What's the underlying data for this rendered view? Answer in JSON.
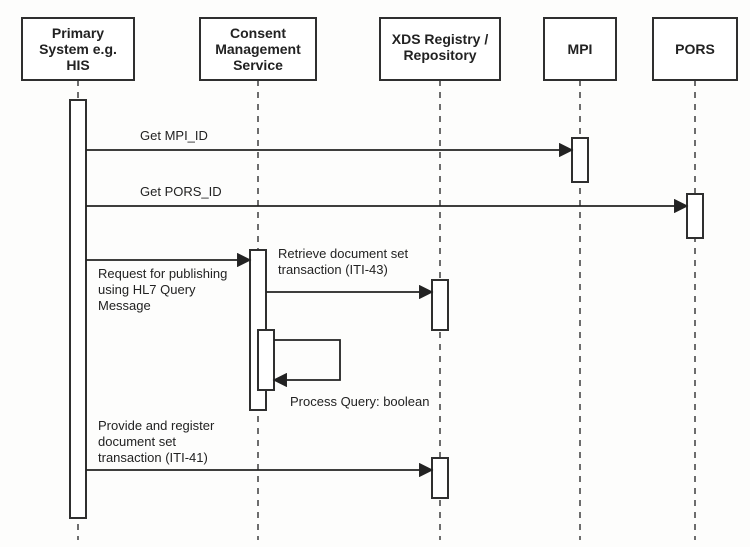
{
  "participants": [
    {
      "id": "primary",
      "lines": [
        "Primary",
        "System e.g.",
        "HIS"
      ]
    },
    {
      "id": "consent",
      "lines": [
        "Consent",
        "Management",
        "Service"
      ]
    },
    {
      "id": "xds",
      "lines": [
        "XDS Registry /",
        "Repository"
      ]
    },
    {
      "id": "mpi",
      "lines": [
        "MPI"
      ]
    },
    {
      "id": "pors",
      "lines": [
        "PORS"
      ]
    }
  ],
  "messages": {
    "m1": "Get MPI_ID",
    "m2": "Get PORS_ID",
    "m3a": "Request for publishing",
    "m3b": "using HL7 Query",
    "m3c": "Message",
    "m4a": "Retrieve document set",
    "m4b": "transaction (ITI-43)",
    "m5": "Process Query: boolean",
    "m6a": "Provide and register",
    "m6b": "document set",
    "m6c": "transaction (ITI-41)"
  },
  "chart_data": {
    "type": "sequence_diagram",
    "participants": [
      "Primary System e.g. HIS",
      "Consent Management Service",
      "XDS Registry / Repository",
      "MPI",
      "PORS"
    ],
    "interactions": [
      {
        "from": "Primary System e.g. HIS",
        "to": "MPI",
        "label": "Get MPI_ID"
      },
      {
        "from": "Primary System e.g. HIS",
        "to": "PORS",
        "label": "Get PORS_ID"
      },
      {
        "from": "Primary System e.g. HIS",
        "to": "Consent Management Service",
        "label": "Request for publishing using HL7 Query Message"
      },
      {
        "from": "Consent Management Service",
        "to": "XDS Registry / Repository",
        "label": "Retrieve document set transaction (ITI-43)"
      },
      {
        "from": "Consent Management Service",
        "to": "Consent Management Service",
        "label": "Process Query: boolean"
      },
      {
        "from": "Primary System e.g. HIS",
        "to": "XDS Registry / Repository",
        "label": "Provide and register document set transaction (ITI-41)"
      }
    ]
  }
}
